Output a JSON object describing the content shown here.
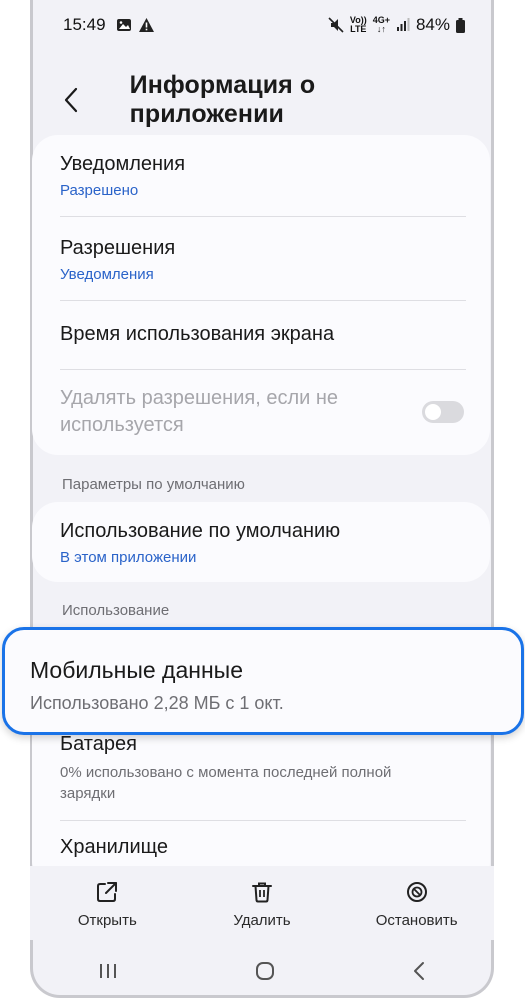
{
  "status": {
    "time": "15:49",
    "volte": "Vo))",
    "lte": "LTE",
    "net": "4G+",
    "battery": "84%"
  },
  "header": {
    "title": "Информация о приложении"
  },
  "card1": {
    "notifications": {
      "title": "Уведомления",
      "sub": "Разрешено"
    },
    "permissions": {
      "title": "Разрешения",
      "sub": "Уведомления"
    },
    "screen_time": {
      "title": "Время использования экрана"
    },
    "remove_perms": {
      "title_line1": "Удалять разрешения, если не",
      "title_line2": "используется"
    }
  },
  "sections": {
    "defaults": "Параметры по умолчанию",
    "usage": "Использование"
  },
  "card2": {
    "title": "Использование по умолчанию",
    "sub": "В этом приложении"
  },
  "mobile_data": {
    "title": "Мобильные данные",
    "sub": "Использовано 2,28 МБ с 1 окт."
  },
  "battery": {
    "title": "Батарея",
    "sub_line1": "0% использовано с момента последней полной",
    "sub_line2": "зарядки"
  },
  "storage": {
    "title": "Хранилище"
  },
  "actions": {
    "open": "Открыть",
    "delete": "Удалить",
    "stop": "Остановить"
  },
  "colors": {
    "accent": "#1a73e8",
    "link": "#2a63c9",
    "background": "#f2f2f7"
  }
}
